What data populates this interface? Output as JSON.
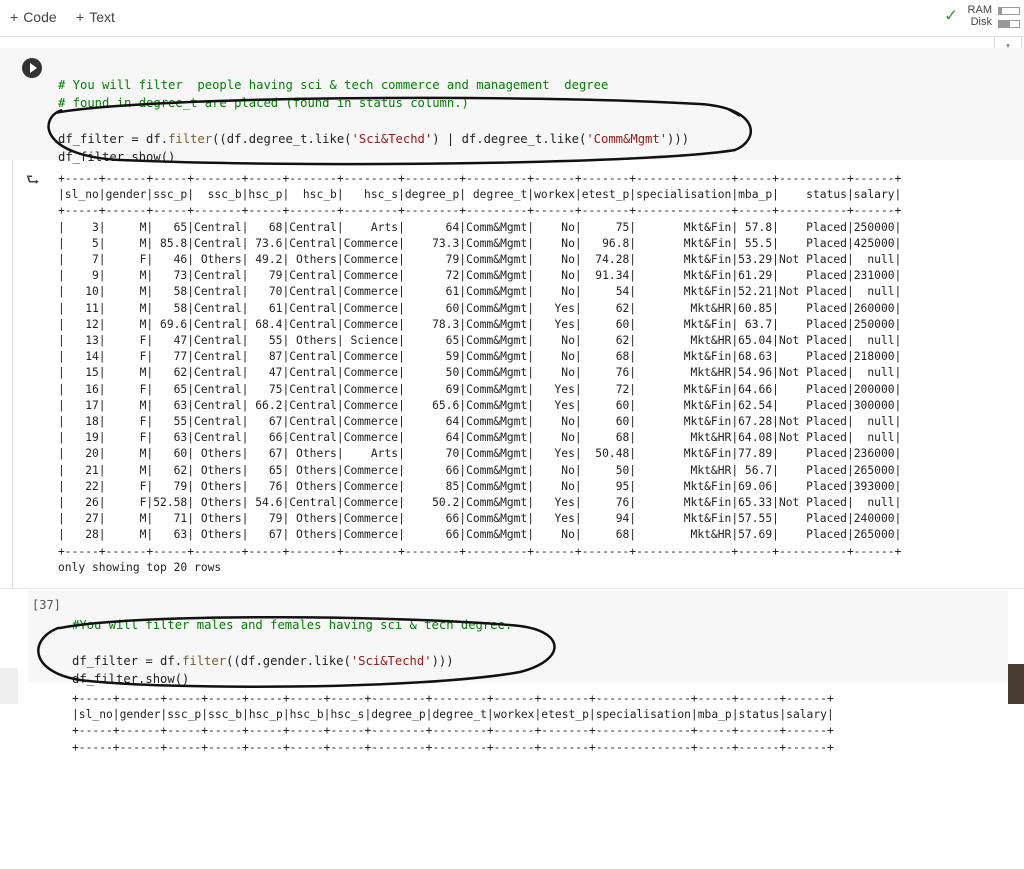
{
  "toolbar": {
    "code_label": "Code",
    "text_label": "Text",
    "ram_label": "RAM",
    "disk_label": "Disk",
    "ram_usage": 0.15,
    "disk_usage": 0.55
  },
  "cell1": {
    "comment1": "# You will filter  people having sci & tech commerce and management  degree",
    "comment2": "# found in degree_t are placed (found in status column.)",
    "line1_a": "df_filter = df.",
    "line1_fn": "filter",
    "line1_b": "((df.degree_t.like(",
    "line1_s1": "'Sci&Techd'",
    "line1_c": ") | df.degree_t.like(",
    "line1_s2": "'Comm&Mgmt'",
    "line1_d": ")))",
    "line2": "df_filter.show()"
  },
  "output1": {
    "columns": [
      "sl_no",
      "gender",
      "ssc_p",
      "ssc_b",
      "hsc_p",
      "hsc_b",
      "hsc_s",
      "degree_p",
      "degree_t",
      "workex",
      "etest_p",
      "specialisation",
      "mba_p",
      "status",
      "salary"
    ],
    "rows": [
      [
        "3",
        "M",
        "65",
        "Central",
        "68",
        "Central",
        "Arts",
        "64",
        "Comm&Mgmt",
        "No",
        "75",
        "Mkt&Fin",
        "57.8",
        "Placed",
        "250000"
      ],
      [
        "5",
        "M",
        "85.8",
        "Central",
        "73.6",
        "Central",
        "Commerce",
        "73.3",
        "Comm&Mgmt",
        "No",
        "96.8",
        "Mkt&Fin",
        "55.5",
        "Placed",
        "425000"
      ],
      [
        "7",
        "F",
        "46",
        "Others",
        "49.2",
        "Others",
        "Commerce",
        "79",
        "Comm&Mgmt",
        "No",
        "74.28",
        "Mkt&Fin",
        "53.29",
        "Not Placed",
        "null"
      ],
      [
        "9",
        "M",
        "73",
        "Central",
        "79",
        "Central",
        "Commerce",
        "72",
        "Comm&Mgmt",
        "No",
        "91.34",
        "Mkt&Fin",
        "61.29",
        "Placed",
        "231000"
      ],
      [
        "10",
        "M",
        "58",
        "Central",
        "70",
        "Central",
        "Commerce",
        "61",
        "Comm&Mgmt",
        "No",
        "54",
        "Mkt&Fin",
        "52.21",
        "Not Placed",
        "null"
      ],
      [
        "11",
        "M",
        "58",
        "Central",
        "61",
        "Central",
        "Commerce",
        "60",
        "Comm&Mgmt",
        "Yes",
        "62",
        "Mkt&HR",
        "60.85",
        "Placed",
        "260000"
      ],
      [
        "12",
        "M",
        "69.6",
        "Central",
        "68.4",
        "Central",
        "Commerce",
        "78.3",
        "Comm&Mgmt",
        "Yes",
        "60",
        "Mkt&Fin",
        "63.7",
        "Placed",
        "250000"
      ],
      [
        "13",
        "F",
        "47",
        "Central",
        "55",
        "Others",
        "Science",
        "65",
        "Comm&Mgmt",
        "No",
        "62",
        "Mkt&HR",
        "65.04",
        "Not Placed",
        "null"
      ],
      [
        "14",
        "F",
        "77",
        "Central",
        "87",
        "Central",
        "Commerce",
        "59",
        "Comm&Mgmt",
        "No",
        "68",
        "Mkt&Fin",
        "68.63",
        "Placed",
        "218000"
      ],
      [
        "15",
        "M",
        "62",
        "Central",
        "47",
        "Central",
        "Commerce",
        "50",
        "Comm&Mgmt",
        "No",
        "76",
        "Mkt&HR",
        "54.96",
        "Not Placed",
        "null"
      ],
      [
        "16",
        "F",
        "65",
        "Central",
        "75",
        "Central",
        "Commerce",
        "69",
        "Comm&Mgmt",
        "Yes",
        "72",
        "Mkt&Fin",
        "64.66",
        "Placed",
        "200000"
      ],
      [
        "17",
        "M",
        "63",
        "Central",
        "66.2",
        "Central",
        "Commerce",
        "65.6",
        "Comm&Mgmt",
        "Yes",
        "60",
        "Mkt&Fin",
        "62.54",
        "Placed",
        "300000"
      ],
      [
        "18",
        "F",
        "55",
        "Central",
        "67",
        "Central",
        "Commerce",
        "64",
        "Comm&Mgmt",
        "No",
        "60",
        "Mkt&Fin",
        "67.28",
        "Not Placed",
        "null"
      ],
      [
        "19",
        "F",
        "63",
        "Central",
        "66",
        "Central",
        "Commerce",
        "64",
        "Comm&Mgmt",
        "No",
        "68",
        "Mkt&HR",
        "64.08",
        "Not Placed",
        "null"
      ],
      [
        "20",
        "M",
        "60",
        "Others",
        "67",
        "Others",
        "Arts",
        "70",
        "Comm&Mgmt",
        "Yes",
        "50.48",
        "Mkt&Fin",
        "77.89",
        "Placed",
        "236000"
      ],
      [
        "21",
        "M",
        "62",
        "Others",
        "65",
        "Others",
        "Commerce",
        "66",
        "Comm&Mgmt",
        "No",
        "50",
        "Mkt&HR",
        "56.7",
        "Placed",
        "265000"
      ],
      [
        "22",
        "F",
        "79",
        "Others",
        "76",
        "Others",
        "Commerce",
        "85",
        "Comm&Mgmt",
        "No",
        "95",
        "Mkt&Fin",
        "69.06",
        "Placed",
        "393000"
      ],
      [
        "26",
        "F",
        "52.58",
        "Others",
        "54.6",
        "Central",
        "Commerce",
        "50.2",
        "Comm&Mgmt",
        "Yes",
        "76",
        "Mkt&Fin",
        "65.33",
        "Not Placed",
        "null"
      ],
      [
        "27",
        "M",
        "71",
        "Others",
        "79",
        "Others",
        "Commerce",
        "66",
        "Comm&Mgmt",
        "Yes",
        "94",
        "Mkt&Fin",
        "57.55",
        "Placed",
        "240000"
      ],
      [
        "28",
        "M",
        "63",
        "Others",
        "67",
        "Others",
        "Commerce",
        "66",
        "Comm&Mgmt",
        "No",
        "68",
        "Mkt&HR",
        "57.69",
        "Placed",
        "265000"
      ]
    ],
    "footer": "only showing top 20 rows"
  },
  "cell2": {
    "exec_count": "[37]",
    "comment": "#You will filter males and females having sci & tech degree.",
    "line1_a": "df_filter = df.",
    "line1_fn": "filter",
    "line1_b": "((df.gender.like(",
    "line1_s1": "'Sci&Techd'",
    "line1_c": ")))",
    "line2": "df_filter.show()"
  },
  "output2": {
    "columns": [
      "sl_no",
      "gender",
      "ssc_p",
      "ssc_b",
      "hsc_p",
      "hsc_b",
      "hsc_s",
      "degree_p",
      "degree_t",
      "workex",
      "etest_p",
      "specialisation",
      "mba_p",
      "status",
      "salary"
    ]
  }
}
